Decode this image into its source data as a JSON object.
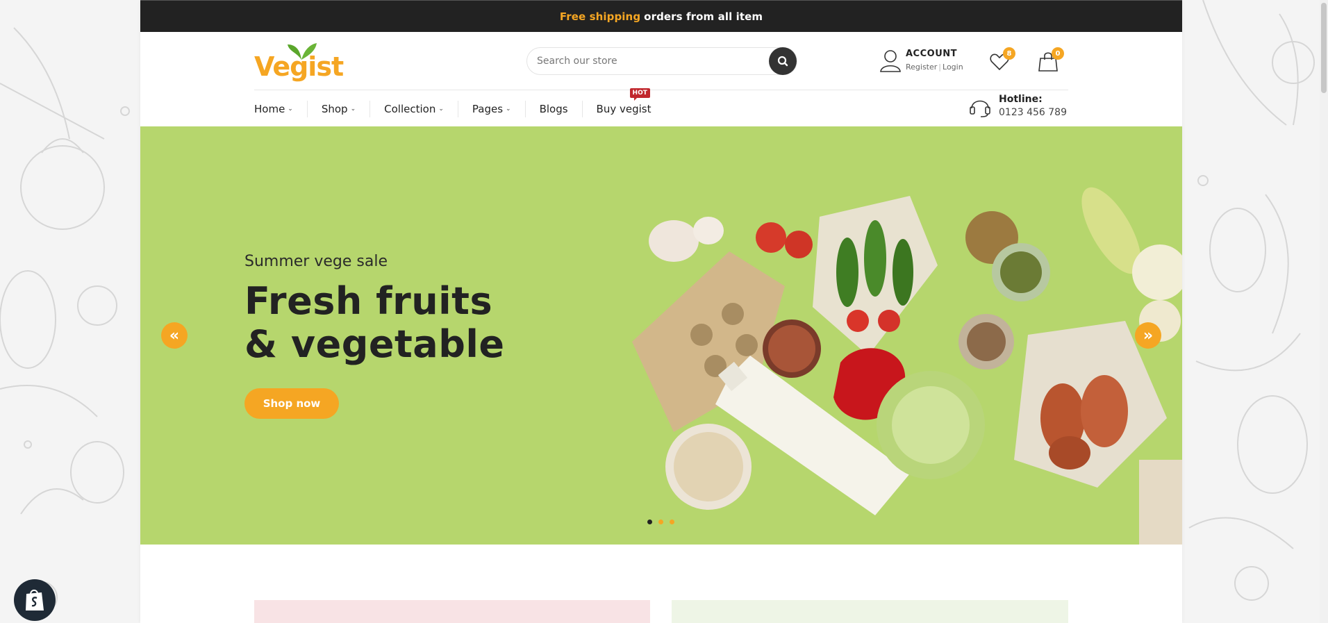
{
  "topbar": {
    "highlight": "Free shipping",
    "text": "orders from all item"
  },
  "logo": {
    "text": "Vegist"
  },
  "search": {
    "placeholder": "Search our store"
  },
  "account": {
    "title": "ACCOUNT",
    "register": "Register",
    "login": "Login"
  },
  "wishlist": {
    "count": "8"
  },
  "cart": {
    "count": "0"
  },
  "nav": {
    "items": [
      "Home",
      "Shop",
      "Collection",
      "Pages",
      "Blogs",
      "Buy vegist"
    ],
    "hot_label": "HOT"
  },
  "hotline": {
    "title": "Hotline:",
    "number": "0123 456 789"
  },
  "hero": {
    "subtitle": "Summer vege sale",
    "title_line1": "Fresh fruits",
    "title_line2": "& vegetable",
    "cta": "Shop now",
    "prev_arrow": "«",
    "next_arrow": "»",
    "slides_count": 3,
    "active_slide": 1
  },
  "colors": {
    "accent": "#f5a623",
    "hero_bg": "#b6d66d",
    "dark": "#222222"
  }
}
